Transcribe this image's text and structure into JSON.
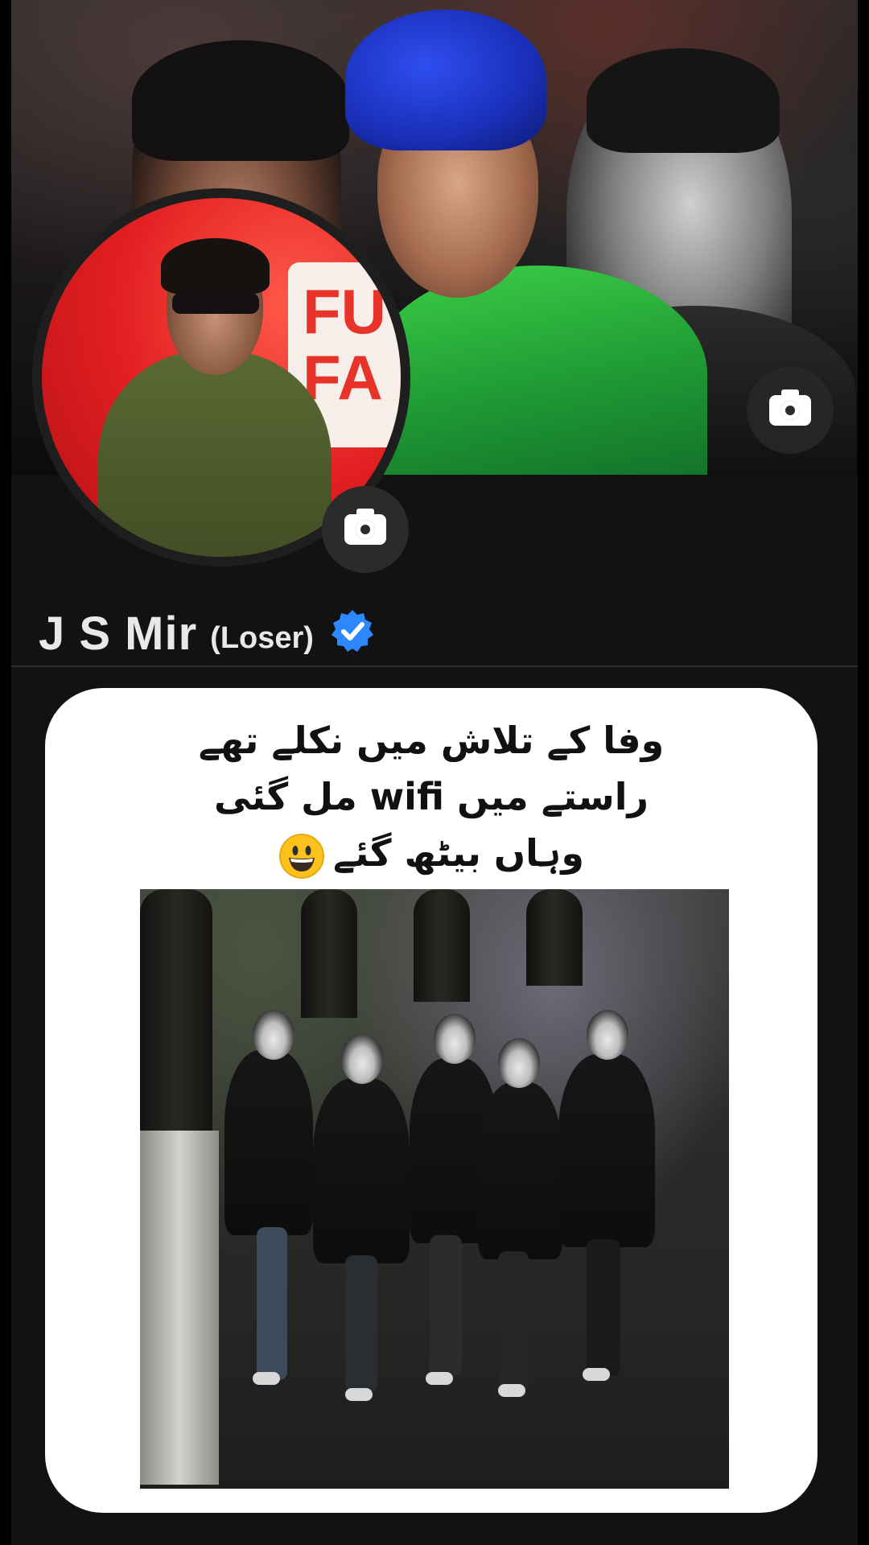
{
  "profile": {
    "name": "J S Mir",
    "name_suffix": "(Loser)",
    "verified": true,
    "verified_color": "#2d88ff"
  },
  "cover": {
    "camera_icon": "camera-icon"
  },
  "avatar": {
    "sign_text": "FU\nFA",
    "camera_icon": "camera-icon"
  },
  "post": {
    "lines": [
      "وفا کے تلاش میں نکلے تھے",
      "راستے میں wifi مل گئی",
      "وہاں بیٹھ گئے"
    ],
    "emoji": "grinning-face-emoji",
    "media": "video-thumbnail"
  },
  "colors": {
    "background": "#000000",
    "profile_panel": "#121212",
    "name_text": "#e8e8e8",
    "card": "#ffffff",
    "card_text": "#111111"
  }
}
